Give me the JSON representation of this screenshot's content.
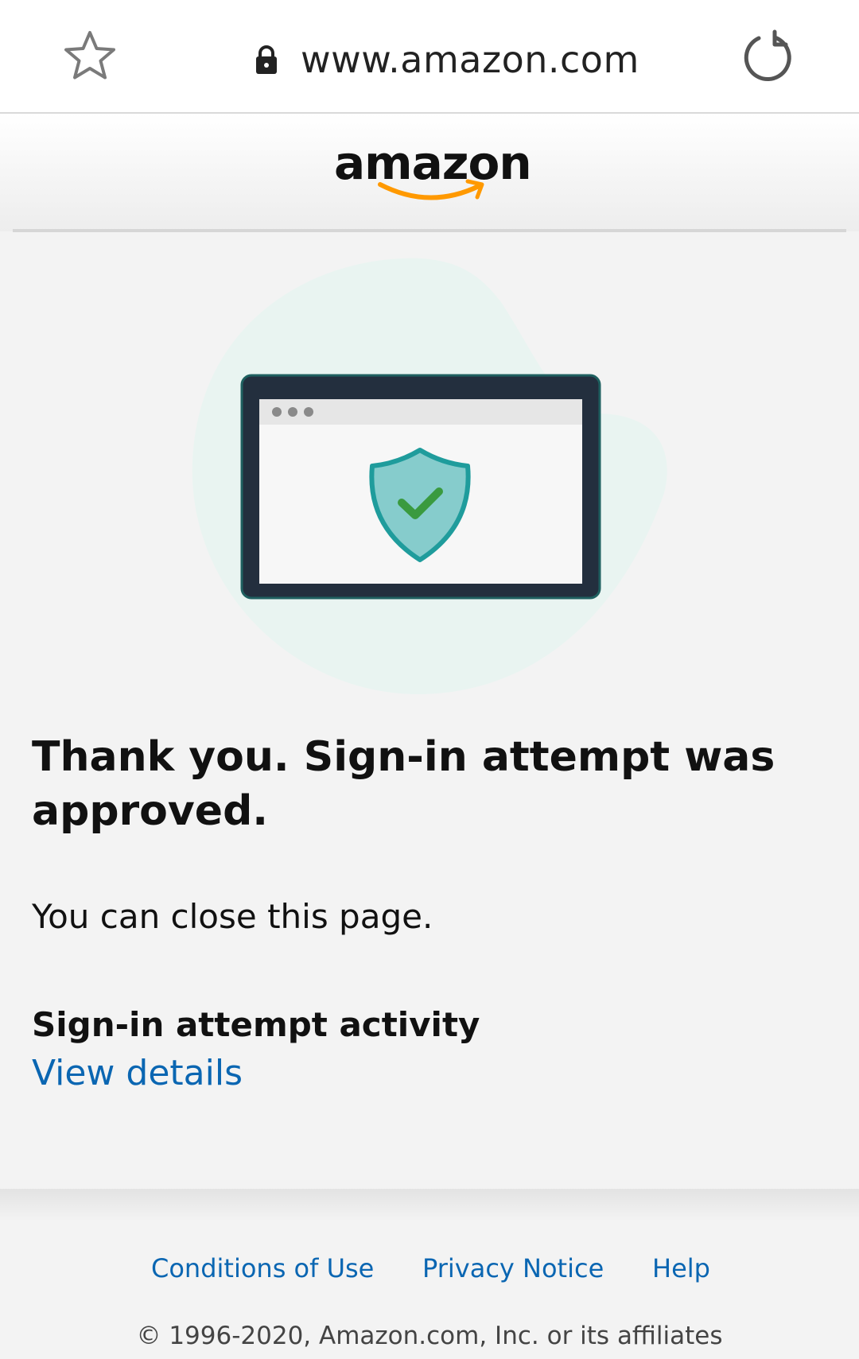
{
  "browser": {
    "url": "www.amazon.com",
    "icons": {
      "bookmark": "star-icon",
      "secure": "lock-icon",
      "reload": "reload-icon"
    }
  },
  "header": {
    "logo_text": "amazon",
    "logo_smile_color": "#ff9900"
  },
  "illustration": {
    "icon": "shield-check-icon",
    "colors": {
      "blob": "#e9f4f1",
      "frame": "#232f3e",
      "shield_fill": "#86cccc",
      "shield_stroke": "#1f9c9c",
      "check": "#3a9a3f"
    }
  },
  "main": {
    "headline": "Thank you. Sign-in attempt was approved.",
    "close_text": "You can close this page.",
    "activity_title": "Sign-in attempt activity",
    "view_details_label": "View details"
  },
  "footer": {
    "links": [
      {
        "label": "Conditions of Use"
      },
      {
        "label": "Privacy Notice"
      },
      {
        "label": "Help"
      }
    ],
    "copyright": "© 1996-2020, Amazon.com, Inc. or its affiliates"
  },
  "colors": {
    "link": "#0a66b2",
    "page_background": "#f3f3f3",
    "text": "#111111"
  }
}
